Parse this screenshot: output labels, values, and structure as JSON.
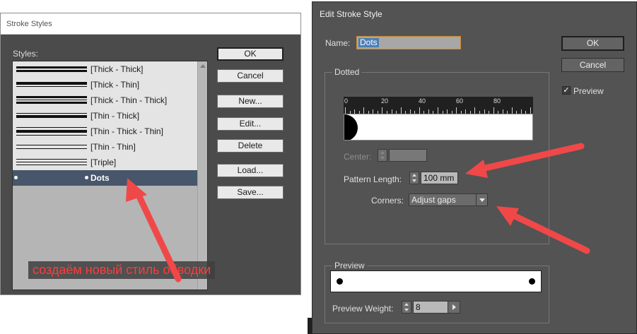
{
  "stroke_styles": {
    "title": "Stroke Styles",
    "styles_label": "Styles:",
    "items": [
      {
        "label": "[Thick - Thick]"
      },
      {
        "label": "[Thick - Thin]"
      },
      {
        "label": "[Thick - Thin - Thick]"
      },
      {
        "label": "[Thin - Thick]"
      },
      {
        "label": "[Thin - Thick - Thin]"
      },
      {
        "label": "[Thin - Thin]"
      },
      {
        "label": "[Triple]"
      },
      {
        "label": "Dots",
        "selected": true
      }
    ],
    "buttons": {
      "ok": "OK",
      "cancel": "Cancel",
      "new": "New...",
      "edit": "Edit...",
      "delete": "Delete",
      "load": "Load...",
      "save": "Save..."
    },
    "annotation": "создаём новый стиль обводки"
  },
  "edit_stroke_style": {
    "title": "Edit Stroke Style",
    "name_label": "Name:",
    "name_value": "Dots",
    "group_title": "Dotted",
    "ruler_labels": [
      "0",
      "20",
      "40",
      "60",
      "80"
    ],
    "center_label": "Center:",
    "center_value": "",
    "pattern_length_label": "Pattern Length:",
    "pattern_length_value": "100 mm",
    "corners_label": "Corners:",
    "corners_value": "Adjust gaps",
    "preview_group_title": "Preview",
    "preview_weight_label": "Preview Weight:",
    "preview_weight_value": "8",
    "buttons": {
      "ok": "OK",
      "cancel": "Cancel"
    },
    "preview_checkbox": {
      "label": "Preview",
      "checked": true,
      "mark": "✓"
    }
  },
  "colors": {
    "annotation_red": "#f04848",
    "selection_blue": "#47566a",
    "dialog_dark": "#535353"
  }
}
